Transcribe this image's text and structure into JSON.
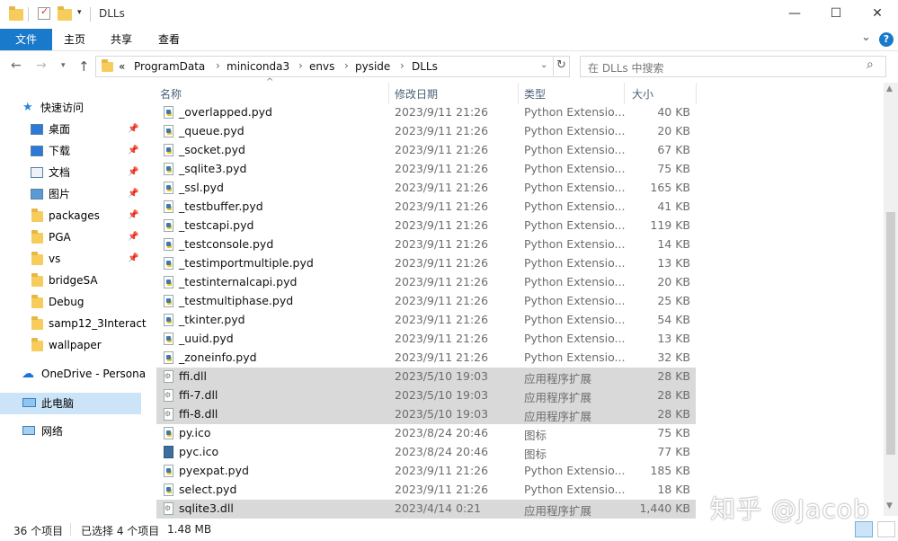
{
  "window": {
    "title": "DLLs",
    "controls": {
      "minimize": "—",
      "maximize": "☐",
      "close": "✕"
    }
  },
  "ribbon": {
    "tabs": [
      "文件",
      "主页",
      "共享",
      "查看"
    ],
    "help": "?",
    "expand": "⌄"
  },
  "address": {
    "overflow": "«",
    "crumbs": [
      "ProgramData",
      "miniconda3",
      "envs",
      "pyside",
      "DLLs"
    ],
    "refresh": "↻"
  },
  "search": {
    "placeholder": "在 DLLs 中搜索",
    "icon": "search-icon"
  },
  "nav": {
    "quick_access": "快速访问",
    "items": [
      {
        "label": "桌面",
        "icon": "desktop-icon",
        "pinned": true
      },
      {
        "label": "下载",
        "icon": "download-icon",
        "pinned": true
      },
      {
        "label": "文档",
        "icon": "document-icon",
        "pinned": true
      },
      {
        "label": "图片",
        "icon": "picture-icon",
        "pinned": true
      },
      {
        "label": "packages",
        "icon": "folder-icon",
        "pinned": true
      },
      {
        "label": "PGA",
        "icon": "folder-icon",
        "pinned": true
      },
      {
        "label": "vs",
        "icon": "folder-icon",
        "pinned": true
      },
      {
        "label": "bridgeSA",
        "icon": "folder-icon",
        "pinned": false
      },
      {
        "label": "Debug",
        "icon": "folder-icon",
        "pinned": false
      },
      {
        "label": "samp12_3Interact",
        "icon": "folder-icon",
        "pinned": false
      },
      {
        "label": "wallpaper",
        "icon": "folder-icon",
        "pinned": false
      }
    ],
    "onedrive": "OneDrive - Persona",
    "this_pc": "此电脑",
    "network": "网络"
  },
  "columns": {
    "name": "名称",
    "date": "修改日期",
    "type": "类型",
    "size": "大小"
  },
  "files": [
    {
      "name": "_overlapped.pyd",
      "date": "2023/9/11 21:26",
      "type": "Python Extensio...",
      "size": "40 KB",
      "kind": "py",
      "selected": false
    },
    {
      "name": "_queue.pyd",
      "date": "2023/9/11 21:26",
      "type": "Python Extensio...",
      "size": "20 KB",
      "kind": "py",
      "selected": false
    },
    {
      "name": "_socket.pyd",
      "date": "2023/9/11 21:26",
      "type": "Python Extensio...",
      "size": "67 KB",
      "kind": "py",
      "selected": false
    },
    {
      "name": "_sqlite3.pyd",
      "date": "2023/9/11 21:26",
      "type": "Python Extensio...",
      "size": "75 KB",
      "kind": "py",
      "selected": false
    },
    {
      "name": "_ssl.pyd",
      "date": "2023/9/11 21:26",
      "type": "Python Extensio...",
      "size": "165 KB",
      "kind": "py",
      "selected": false
    },
    {
      "name": "_testbuffer.pyd",
      "date": "2023/9/11 21:26",
      "type": "Python Extensio...",
      "size": "41 KB",
      "kind": "py",
      "selected": false
    },
    {
      "name": "_testcapi.pyd",
      "date": "2023/9/11 21:26",
      "type": "Python Extensio...",
      "size": "119 KB",
      "kind": "py",
      "selected": false
    },
    {
      "name": "_testconsole.pyd",
      "date": "2023/9/11 21:26",
      "type": "Python Extensio...",
      "size": "14 KB",
      "kind": "py",
      "selected": false
    },
    {
      "name": "_testimportmultiple.pyd",
      "date": "2023/9/11 21:26",
      "type": "Python Extensio...",
      "size": "13 KB",
      "kind": "py",
      "selected": false
    },
    {
      "name": "_testinternalcapi.pyd",
      "date": "2023/9/11 21:26",
      "type": "Python Extensio...",
      "size": "20 KB",
      "kind": "py",
      "selected": false
    },
    {
      "name": "_testmultiphase.pyd",
      "date": "2023/9/11 21:26",
      "type": "Python Extensio...",
      "size": "25 KB",
      "kind": "py",
      "selected": false
    },
    {
      "name": "_tkinter.pyd",
      "date": "2023/9/11 21:26",
      "type": "Python Extensio...",
      "size": "54 KB",
      "kind": "py",
      "selected": false
    },
    {
      "name": "_uuid.pyd",
      "date": "2023/9/11 21:26",
      "type": "Python Extensio...",
      "size": "13 KB",
      "kind": "py",
      "selected": false
    },
    {
      "name": "_zoneinfo.pyd",
      "date": "2023/9/11 21:26",
      "type": "Python Extensio...",
      "size": "32 KB",
      "kind": "py",
      "selected": false
    },
    {
      "name": "ffi.dll",
      "date": "2023/5/10 19:03",
      "type": "应用程序扩展",
      "size": "28 KB",
      "kind": "dll",
      "selected": true
    },
    {
      "name": "ffi-7.dll",
      "date": "2023/5/10 19:03",
      "type": "应用程序扩展",
      "size": "28 KB",
      "kind": "dll",
      "selected": true
    },
    {
      "name": "ffi-8.dll",
      "date": "2023/5/10 19:03",
      "type": "应用程序扩展",
      "size": "28 KB",
      "kind": "dll",
      "selected": true
    },
    {
      "name": "py.ico",
      "date": "2023/8/24 20:46",
      "type": "图标",
      "size": "75 KB",
      "kind": "py",
      "selected": false
    },
    {
      "name": "pyc.ico",
      "date": "2023/8/24 20:46",
      "type": "图标",
      "size": "77 KB",
      "kind": "pyc",
      "selected": false
    },
    {
      "name": "pyexpat.pyd",
      "date": "2023/9/11 21:26",
      "type": "Python Extensio...",
      "size": "185 KB",
      "kind": "py",
      "selected": false
    },
    {
      "name": "select.pyd",
      "date": "2023/9/11 21:26",
      "type": "Python Extensio...",
      "size": "18 KB",
      "kind": "py",
      "selected": false
    },
    {
      "name": "sqlite3.dll",
      "date": "2023/4/14 0:21",
      "type": "应用程序扩展",
      "size": "1,440 KB",
      "kind": "dll",
      "selected": true
    }
  ],
  "status": {
    "count": "36 个项目",
    "selected": "已选择 4 个项目",
    "size": "1.48 MB"
  },
  "watermark": "知乎 @Jacob",
  "colors": {
    "accent": "#1979ca",
    "selection": "#d9d9d9"
  }
}
